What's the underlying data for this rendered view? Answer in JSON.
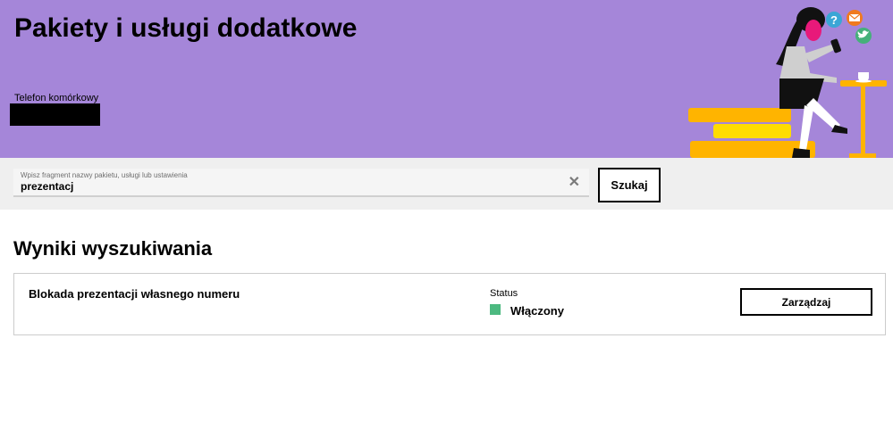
{
  "header": {
    "title": "Pakiety i usługi dodatkowe",
    "phone_label": "Telefon komórkowy"
  },
  "search": {
    "placeholder": "Wpisz fragment nazwy pakietu, usługi lub ustawienia",
    "value": "prezentacj",
    "clear_symbol": "✕",
    "button_label": "Szukaj"
  },
  "results": {
    "title": "Wyniki wyszukiwania",
    "items": [
      {
        "name": "Blokada prezentacji własnego numeru",
        "status_label": "Status",
        "status_value": "Włączony",
        "status_color": "#4cb980",
        "action_label": "Zarządzaj"
      }
    ]
  },
  "colors": {
    "banner": "#a586d9",
    "accent_yellow": "#ffb400"
  },
  "illustration": {
    "icons": [
      "question-bubble-icon",
      "mail-bubble-icon",
      "twitter-bubble-icon"
    ]
  }
}
